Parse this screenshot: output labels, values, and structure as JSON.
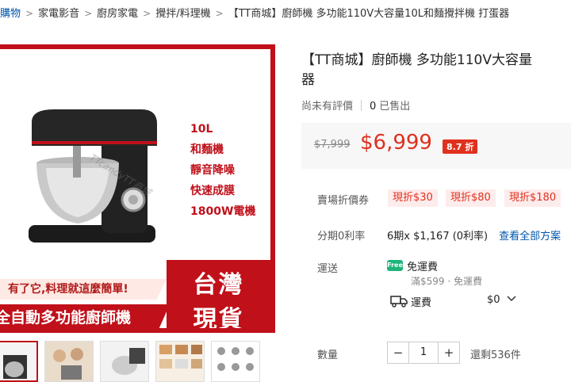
{
  "breadcrumb": {
    "items": [
      "購物",
      "家電影音",
      "廚房家電",
      "攪拌/料理機",
      "【TT商城】廚師機 多功能110V大容量10L和麵攪拌機 打蛋器"
    ],
    "separator": ">"
  },
  "image": {
    "specs": [
      "10L",
      "和麵機",
      "靜音降噪",
      "快速成膜",
      "1800W電機"
    ],
    "watermark": "TTcandyTT商城",
    "slogan_top": "有了它,料理就這麼簡單!",
    "slogan_main": "全自動多功能廚師機",
    "badge_line1": "台灣",
    "badge_line2": "現貨"
  },
  "product": {
    "title": "【TT商城】廚師機 多功能110V大容量",
    "title_line2": "器",
    "rating_text": "尚未有評價",
    "sold_count": "0",
    "sold_label": "已售出"
  },
  "price": {
    "original": "$7,999",
    "current": "$6,999",
    "discount": "8.7 折"
  },
  "promotions": {
    "label": "賣場折價券",
    "coupons": [
      "現折$30",
      "現折$80",
      "現折$180"
    ]
  },
  "installment": {
    "label": "分期0利率",
    "text": "6期x $1,167 (0利率)",
    "link": "查看全部方案"
  },
  "shipping": {
    "label": "運送",
    "free_icon": "Free",
    "free_text": "免運費",
    "free_condition": "滿$599 · 免運費",
    "fee_label": "運費",
    "fee_value": "$0",
    "truck_icon": "truck-icon"
  },
  "quantity": {
    "label": "數量",
    "minus": "−",
    "value": "1",
    "plus": "+",
    "stock": "還剩536件"
  },
  "colors": {
    "brand_red": "#c0101a",
    "price_red": "#e0301e",
    "link_blue": "#0055aa"
  }
}
